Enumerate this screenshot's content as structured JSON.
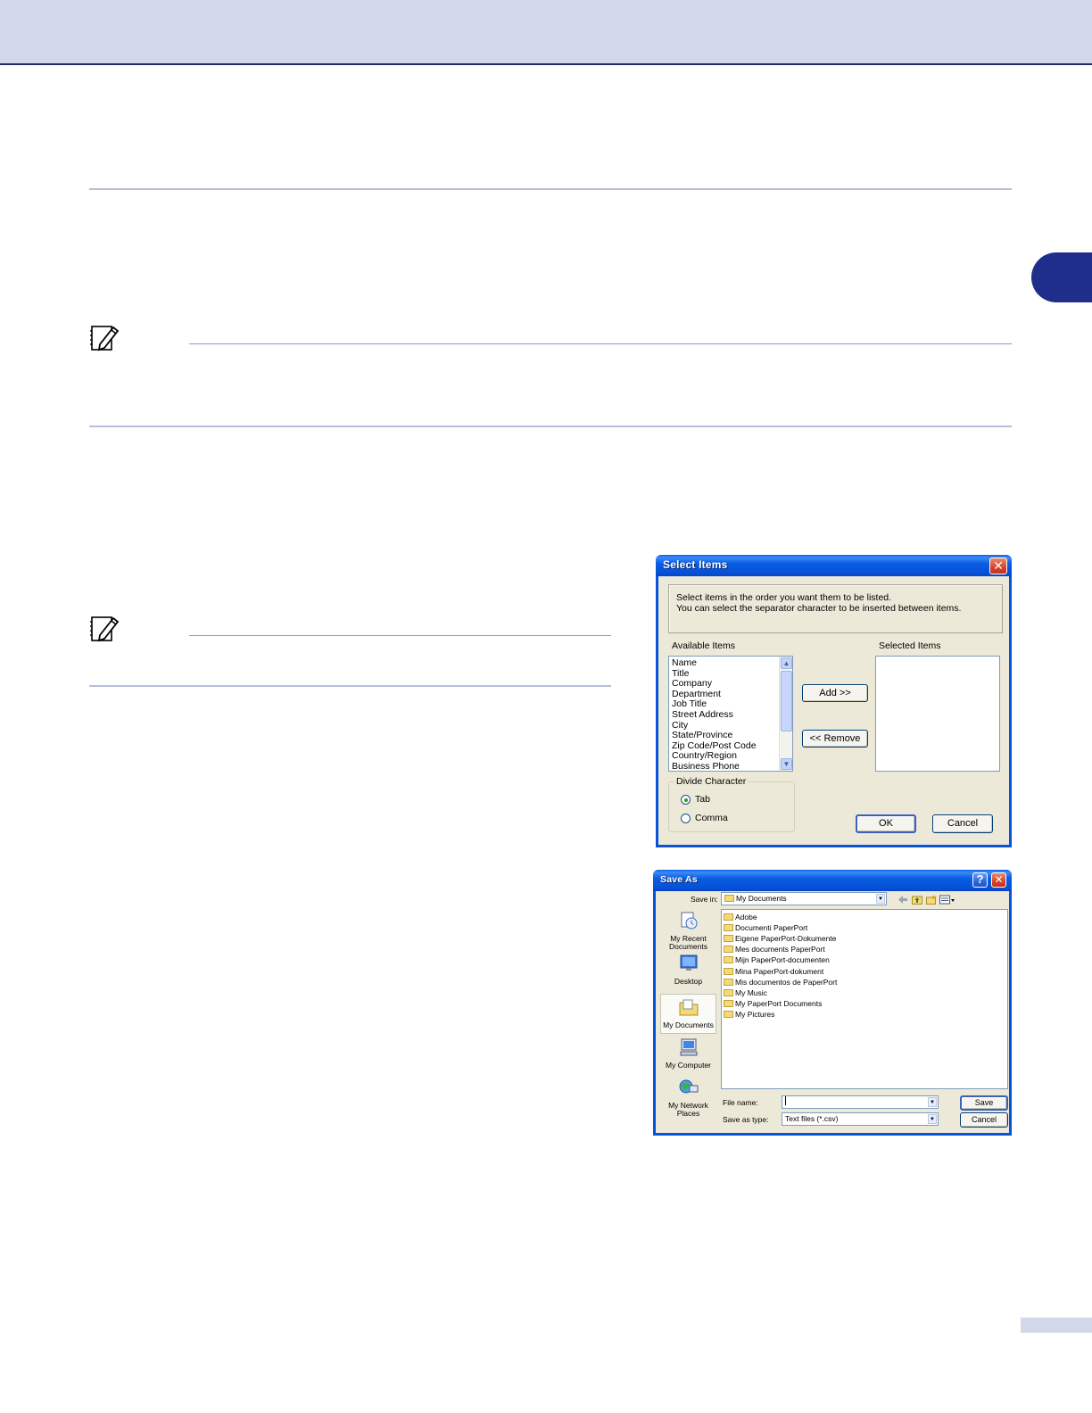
{
  "select_items_dialog": {
    "title": "Select Items",
    "close_glyph": "✕",
    "instructions": [
      "Select items in the order you want them to be listed.",
      "You can select the separator character to be inserted between items."
    ],
    "available_items_label": "Available Items",
    "selected_items_label": "Selected Items",
    "available_items": [
      "Name",
      "Title",
      "Company",
      "Department",
      "Job Title",
      "Street Address",
      "City",
      "State/Province",
      "Zip Code/Post Code",
      "Country/Region",
      "Business Phone"
    ],
    "add_button": "Add >>",
    "remove_button": "<< Remove",
    "divide_character_label": "Divide Character",
    "options": [
      "Tab",
      "Comma"
    ],
    "selected_option": "Tab",
    "ok_button": "OK",
    "cancel_button": "Cancel"
  },
  "save_as_dialog": {
    "title": "Save As",
    "help_glyph": "?",
    "close_glyph": "✕",
    "save_in_label": "Save in:",
    "save_in_value": "My Documents",
    "places": [
      "My Recent Documents",
      "Desktop",
      "My Documents",
      "My Computer",
      "My Network Places"
    ],
    "selected_place": "My Documents",
    "files": [
      "Adobe",
      "Documenti PaperPort",
      "Eigene PaperPort-Dokumente",
      "Mes documents PaperPort",
      "Mijn PaperPort-documenten",
      "Mina PaperPort-dokument",
      "Mis documentos de PaperPort",
      "My Music",
      "My PaperPort Documents",
      "My Pictures"
    ],
    "file_name_label": "File name:",
    "file_name_value": "",
    "save_as_type_label": "Save as type:",
    "save_as_type_value": "Text files (*.csv)",
    "save_button": "Save",
    "cancel_button": "Cancel"
  },
  "colors": {
    "header_band": "#d1d8e9",
    "chapter_tab": "#1f2e8a",
    "xp_title_blue": "#0a52d6",
    "dialog_face": "#ece9d8"
  }
}
